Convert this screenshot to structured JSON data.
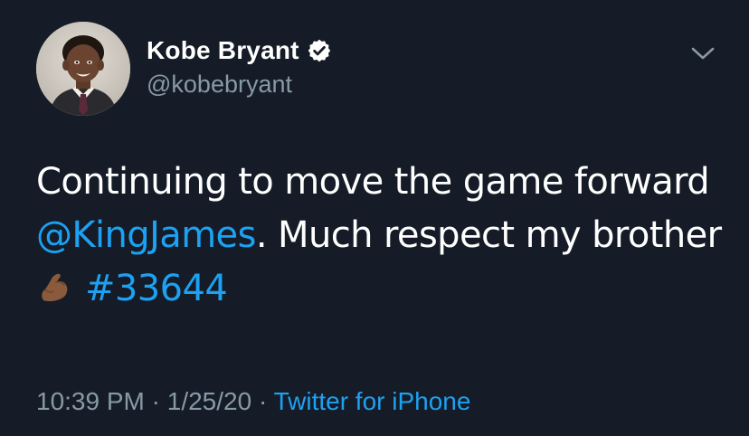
{
  "tweet": {
    "author": {
      "name": "Kobe Bryant",
      "handle": "@kobebryant",
      "verified": true
    },
    "body": {
      "line1": "Continuing to move the game forward",
      "mention": "@KingJames",
      "after_mention": ". Much respect my brother",
      "emoji": "flexed-biceps-emoji",
      "hashtag": "#33644"
    },
    "meta": {
      "time": "10:39 PM",
      "separator": "·",
      "date": "1/25/20",
      "source": "Twitter for iPhone"
    }
  },
  "colors": {
    "background": "#151c27",
    "text": "#ffffff",
    "secondary": "#8899a6",
    "link": "#1da1f2"
  }
}
